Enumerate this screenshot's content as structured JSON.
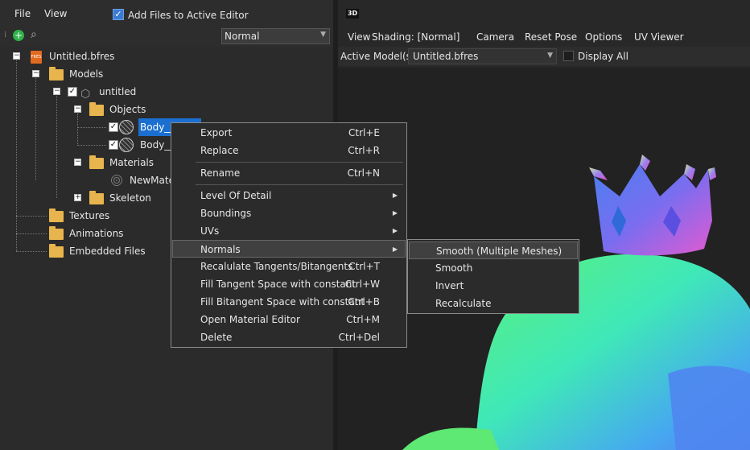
{
  "menubar": {
    "file": "File",
    "view": "View"
  },
  "add_files": {
    "checked": true,
    "label": "Add Files to Active Editor"
  },
  "mode_select": {
    "value": "Normal"
  },
  "tree": {
    "root": "Untitled.bfres",
    "models": "Models",
    "model": "untitled",
    "objects": "Objects",
    "body1": "Body__m",
    "body2": "Body__m",
    "materials": "Materials",
    "material1": "NewMateri",
    "skeleton": "Skeleton",
    "textures": "Textures",
    "animations": "Animations",
    "embedded": "Embedded Files"
  },
  "viewer": {
    "title": "3D",
    "menus": [
      "View",
      "Shading: [Normal]",
      "Camera",
      "Reset Pose",
      "Options",
      "UV Viewer"
    ],
    "active_model_label": "Active Model(s):",
    "active_model_value": "Untitled.bfres",
    "display_all": "Display All"
  },
  "context_menu": {
    "items": [
      {
        "label": "Export",
        "shortcut": "Ctrl+E"
      },
      {
        "label": "Replace",
        "shortcut": "Ctrl+R"
      },
      {
        "label": "Rename",
        "shortcut": "Ctrl+N"
      },
      {
        "label": "Level Of Detail",
        "shortcut": ""
      },
      {
        "label": "Boundings",
        "shortcut": ""
      },
      {
        "label": "UVs",
        "shortcut": ""
      },
      {
        "label": "Normals",
        "shortcut": ""
      },
      {
        "label": "Recalulate Tangents/Bitangents",
        "shortcut": "Ctrl+T"
      },
      {
        "label": "Fill Tangent Space with constant",
        "shortcut": "Ctrl+W"
      },
      {
        "label": "Fill Bitangent Space with constant",
        "shortcut": "Ctrl+B"
      },
      {
        "label": "Open Material Editor",
        "shortcut": "Ctrl+M"
      },
      {
        "label": "Delete",
        "shortcut": "Ctrl+Del"
      }
    ]
  },
  "normals_submenu": {
    "items": [
      "Smooth (Multiple Meshes)",
      "Smooth",
      "Invert",
      "Recalculate"
    ]
  },
  "colors": {
    "selection": "#1a6fd1",
    "folder": "#e8b44d",
    "accent_green": "#2fb24a"
  }
}
